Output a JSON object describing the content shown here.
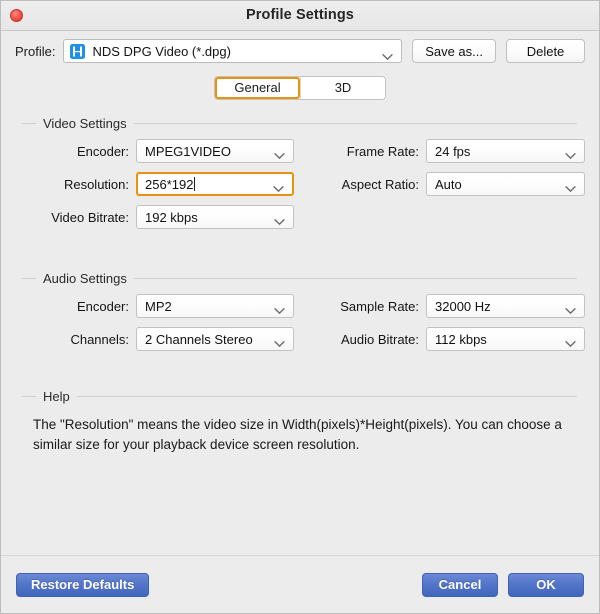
{
  "window": {
    "title": "Profile Settings",
    "close_icon": "close-button-red"
  },
  "profile_row": {
    "label": "Profile:",
    "icon": "profile-format-icon",
    "value": "NDS DPG Video (*.dpg)",
    "dropdown_icon": "chevron-down-icon",
    "save_as_label": "Save as...",
    "delete_label": "Delete"
  },
  "tabs": [
    {
      "label": "General",
      "selected": true
    },
    {
      "label": "3D",
      "selected": false
    }
  ],
  "video_settings": {
    "title": "Video Settings",
    "fields": [
      {
        "label": "Encoder:",
        "value": "MPEG1VIDEO",
        "focused": false,
        "column": "left"
      },
      {
        "label": "Frame Rate:",
        "value": "24 fps",
        "focused": false,
        "column": "right"
      },
      {
        "label": "Resolution:",
        "value": "256*192",
        "focused": true,
        "column": "left"
      },
      {
        "label": "Aspect Ratio:",
        "value": "Auto",
        "focused": false,
        "column": "right"
      },
      {
        "label": "Video Bitrate:",
        "value": "192 kbps",
        "focused": false,
        "column": "left"
      }
    ]
  },
  "audio_settings": {
    "title": "Audio Settings",
    "fields": [
      {
        "label": "Encoder:",
        "value": "MP2",
        "focused": false,
        "column": "left"
      },
      {
        "label": "Sample Rate:",
        "value": "32000 Hz",
        "focused": false,
        "column": "right"
      },
      {
        "label": "Channels:",
        "value": "2 Channels Stereo",
        "focused": false,
        "column": "left"
      },
      {
        "label": "Audio Bitrate:",
        "value": "112 kbps",
        "focused": false,
        "column": "right"
      }
    ]
  },
  "help": {
    "title": "Help",
    "text": "The \"Resolution\" means the video size in Width(pixels)*Height(pixels).  You can choose a similar size for your playback device screen resolution."
  },
  "footer": {
    "restore_defaults_label": "Restore Defaults",
    "cancel_label": "Cancel",
    "ok_label": "OK"
  },
  "colors": {
    "accent_focus": "#e8920f",
    "button_blue": "#4f73c6",
    "window_bg": "#ececec",
    "close_red": "#f4594e"
  }
}
